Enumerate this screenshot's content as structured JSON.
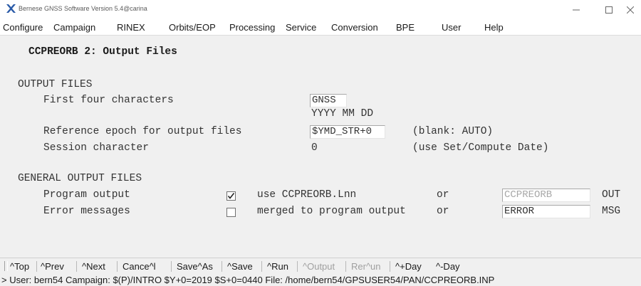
{
  "window": {
    "title": "Bernese GNSS Software Version 5.4@carina"
  },
  "menu": [
    {
      "label": "Configure"
    },
    {
      "label": "Campaign"
    },
    {
      "label": "RINEX"
    },
    {
      "label": "Orbits/EOP"
    },
    {
      "label": "Processing"
    },
    {
      "label": "Service"
    },
    {
      "label": "Conversion"
    },
    {
      "label": "BPE"
    },
    {
      "label": "User"
    },
    {
      "label": "Help"
    }
  ],
  "panel": {
    "heading": "CCPREORB 2: Output Files",
    "output_files": {
      "section_label": "OUTPUT FILES",
      "first_four_label": "First four characters",
      "first_four_value": "GNSS",
      "date_format_hint": "YYYY MM DD",
      "ref_epoch_label": "Reference epoch for output files",
      "ref_epoch_value": "$YMD_STR+0",
      "ref_epoch_hint": "(blank: AUTO)",
      "session_label": "Session character",
      "session_value": "0",
      "session_hint": "(use Set/Compute Date)"
    },
    "general_output": {
      "section_label": "GENERAL OUTPUT FILES",
      "program_output_label": "Program output",
      "program_output_checked": true,
      "program_output_option": "use CCPREORB.Lnn",
      "program_output_or": "or",
      "program_output_file": "CCPREORB",
      "program_output_ext": "OUT",
      "error_label": "Error messages",
      "error_checked": false,
      "error_option": "merged to program output",
      "error_or": "or",
      "error_file": "ERROR",
      "error_ext": "MSG"
    }
  },
  "toolbar": {
    "top": "^Top",
    "prev": "^Prev",
    "next": "^Next",
    "cancel": "Cance^l",
    "save_as": "Save^As",
    "save": "^Save",
    "run": "^Run",
    "output": "^Output",
    "rerun": "Rer^un",
    "plus_day": "^+Day",
    "minus_day": "^-Day"
  },
  "status": {
    "text": "> User: bern54  Campaign: $(P)/INTRO  $Y+0=2019  $S+0=0440   File: /home/bern54/GPSUSER54/PAN/CCPREORB.INP"
  },
  "colors": {
    "app_icon": "#2b5ba8",
    "window_bg": "#f0f0f0",
    "disabled_text": "#a8a8a8"
  }
}
